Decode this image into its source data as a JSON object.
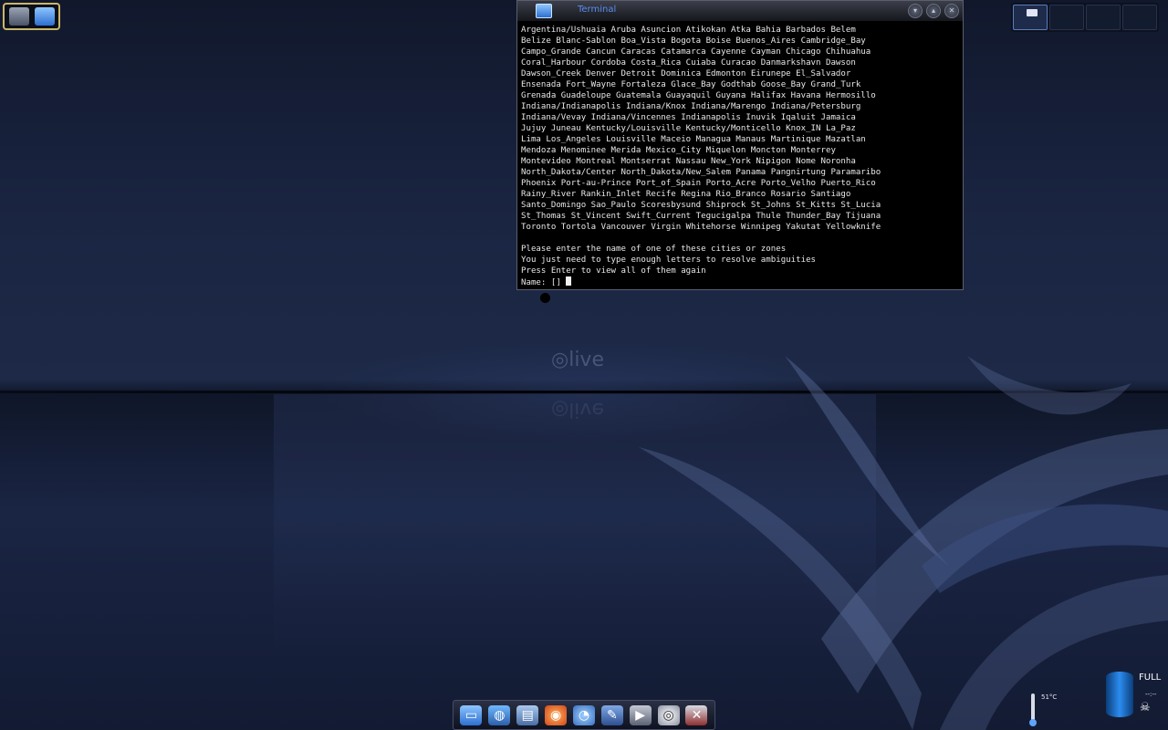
{
  "terminal": {
    "title": "Terminal",
    "lines": [
      "Argentina/Ushuaia Aruba Asuncion Atikokan Atka Bahia Barbados Belem",
      "Belize Blanc-Sablon Boa_Vista Bogota Boise Buenos_Aires Cambridge_Bay",
      "Campo_Grande Cancun Caracas Catamarca Cayenne Cayman Chicago Chihuahua",
      "Coral_Harbour Cordoba Costa_Rica Cuiaba Curacao Danmarkshavn Dawson",
      "Dawson_Creek Denver Detroit Dominica Edmonton Eirunepe El_Salvador",
      "Ensenada Fort_Wayne Fortaleza Glace_Bay Godthab Goose_Bay Grand_Turk",
      "Grenada Guadeloupe Guatemala Guayaquil Guyana Halifax Havana Hermosillo",
      "Indiana/Indianapolis Indiana/Knox Indiana/Marengo Indiana/Petersburg",
      "Indiana/Vevay Indiana/Vincennes Indianapolis Inuvik Iqaluit Jamaica",
      "Jujuy Juneau Kentucky/Louisville Kentucky/Monticello Knox_IN La_Paz",
      "Lima Los_Angeles Louisville Maceio Managua Manaus Martinique Mazatlan",
      "Mendoza Menominee Merida Mexico_City Miquelon Moncton Monterrey",
      "Montevideo Montreal Montserrat Nassau New_York Nipigon Nome Noronha",
      "North_Dakota/Center North_Dakota/New_Salem Panama Pangnirtung Paramaribo",
      "Phoenix Port-au-Prince Port_of_Spain Porto_Acre Porto_Velho Puerto_Rico",
      "Rainy_River Rankin_Inlet Recife Regina Rio_Branco Rosario Santiago",
      "Santo_Domingo Sao_Paulo Scoresbysund Shiprock St_Johns St_Kitts St_Lucia",
      "St_Thomas St_Vincent Swift_Current Tegucigalpa Thule Thunder_Bay Tijuana",
      "Toronto Tortola Vancouver Virgin Whitehorse Winnipeg Yakutat Yellowknife",
      "",
      "Please enter the name of one of these cities or zones",
      "You just need to type enough letters to resolve ambiguities",
      "Press Enter to view all of them again"
    ],
    "prompt": "Name: [] "
  },
  "desktop": {
    "logo_text": "live"
  },
  "widgets": {
    "temperature": "51°C",
    "battery_status": "FULL",
    "battery_time": "--:--"
  },
  "dock_icons": [
    "computer-icon",
    "network-icon",
    "files-icon",
    "browser-icon",
    "messenger-icon",
    "graphics-icon",
    "media-icon",
    "disc-icon",
    "tools-icon"
  ]
}
